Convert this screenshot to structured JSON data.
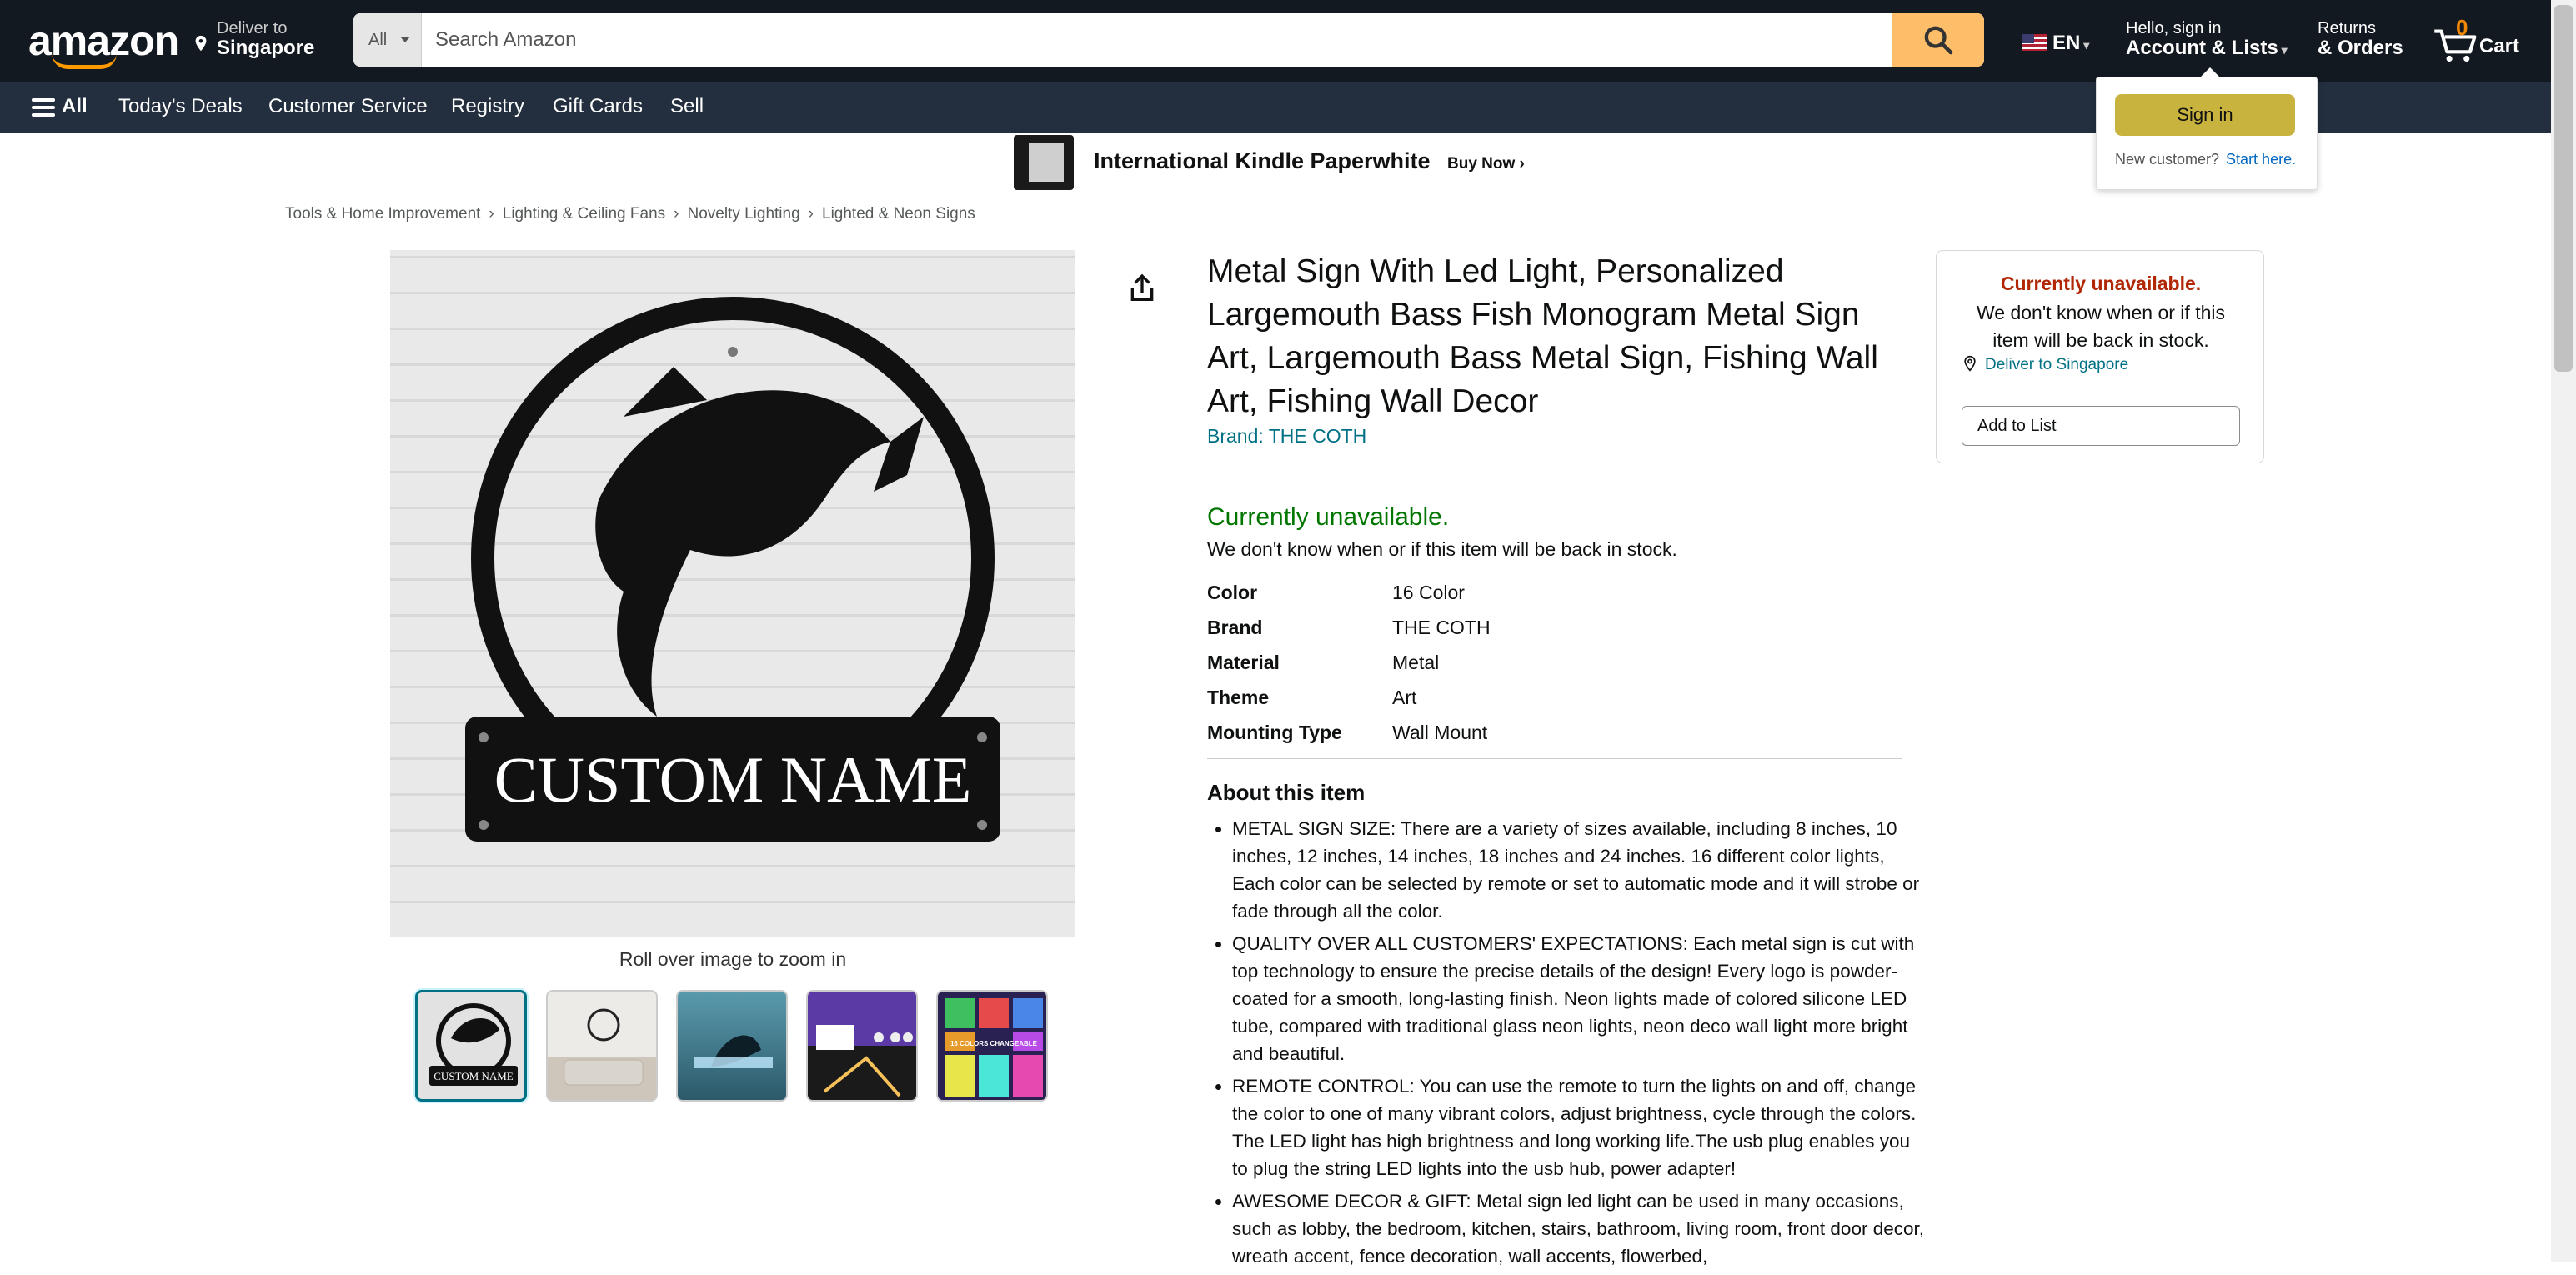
{
  "nav": {
    "logo": "amazon",
    "deliver_line1": "Deliver to",
    "deliver_line2": "Singapore",
    "search_category": "All",
    "search_placeholder": "Search Amazon",
    "language": "EN",
    "account_line1": "Hello, sign in",
    "account_line2": "Account & Lists",
    "returns_line1": "Returns",
    "returns_line2": "& Orders",
    "cart_count": "0",
    "cart_label": "Cart"
  },
  "subnav": {
    "all": "All",
    "items": [
      "Today's Deals",
      "Customer Service",
      "Registry",
      "Gift Cards",
      "Sell"
    ]
  },
  "signin_flyout": {
    "button": "Sign in",
    "new_customer": "New customer?",
    "start_here": "Start here."
  },
  "banner": {
    "title": "International Kindle Paperwhite",
    "cta": "Buy Now ›"
  },
  "breadcrumb": [
    "Tools & Home Improvement",
    "Lighting & Ceiling Fans",
    "Novelty Lighting",
    "Lighted & Neon Signs"
  ],
  "image": {
    "sign_text": "CUSTOM NAME",
    "zoom_hint": "Roll over image to zoom in",
    "thumb1_text": "CUSTOM NAME",
    "thumb5_text": "16 COLORS CHANGEABLE"
  },
  "product": {
    "title": "Metal Sign With Led Light, Personalized Largemouth Bass Fish Monogram Metal Sign Art, Largemouth Bass Metal Sign, Fishing Wall Art, Fishing Wall Decor",
    "brand_link": "Brand: THE COTH",
    "availability": "Currently unavailable.",
    "availability_sub": "We don't know when or if this item will be back in stock.",
    "specs": [
      {
        "k": "Color",
        "v": "16 Color"
      },
      {
        "k": "Brand",
        "v": "THE COTH"
      },
      {
        "k": "Material",
        "v": "Metal"
      },
      {
        "k": "Theme",
        "v": "Art"
      },
      {
        "k": "Mounting Type",
        "v": "Wall Mount"
      }
    ],
    "about_heading": "About this item",
    "bullets": [
      "METAL SIGN SIZE: There are a variety of sizes available, including 8 inches, 10 inches, 12 inches, 14 inches, 18 inches and 24 inches. 16 different color lights, Each color can be selected by remote or set to automatic mode and it will strobe or fade through all the color.",
      "QUALITY OVER ALL CUSTOMERS' EXPECTATIONS: Each metal sign is cut with top technology to ensure the precise details of the design! Every logo is powder-coated for a smooth, long-lasting finish. Neon lights made of colored silicone LED tube, compared with traditional glass neon lights, neon deco wall light more bright and beautiful.",
      "REMOTE CONTROL: You can use the remote to turn the lights on and off, change the color to one of many vibrant colors, adjust brightness, cycle through the colors. The LED light has high brightness and long working life.The usb plug enables you to plug the string LED lights into the usb hub, power adapter!",
      "AWESOME DECOR & GIFT: Metal sign led light can be used in many occasions, such as lobby, the bedroom, kitchen, stairs, bathroom, living room, front door decor, wreath accent, fence decoration, wall accents, flowerbed,"
    ]
  },
  "buybox": {
    "status": "Currently unavailable.",
    "status_sub": "We don't know when or if this item will be back in stock.",
    "deliver": "Deliver to Singapore",
    "add_to_list": "Add to List"
  }
}
